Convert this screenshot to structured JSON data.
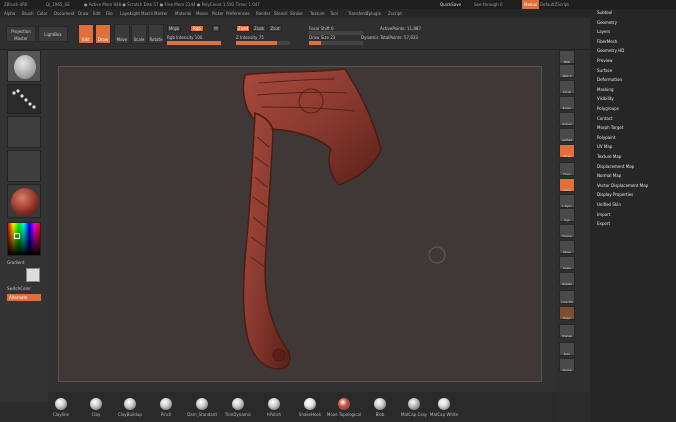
{
  "titlebar": {
    "app": "ZBrush 4R6",
    "file": "Qi_1965_UE",
    "stats": "● Active Mem 848 ● Scratch Disk 57 ● Free Mem 2144 ● PolyCount 1.592 Timer 1.047",
    "quicksave": "QuickSave",
    "see_through": "See-through",
    "see_through_value": "0",
    "menus_label": "Menus",
    "default_script": "DefaultZScript"
  },
  "menubar": [
    "Alpha",
    "Brush",
    "Color",
    "Document",
    "Draw",
    "Edit",
    "File",
    "Layer",
    "Light",
    "Macro",
    "Marker",
    "Material",
    "Movie",
    "Picker",
    "Preferences",
    "Render",
    "Stencil",
    "Stroke",
    "Texture",
    "Tool",
    "Transform",
    "Zplugin",
    "Zscript"
  ],
  "shelf": {
    "projection_master": "Projection Master",
    "lightbox": "LightBox",
    "edit": "Edit",
    "draw": "Draw",
    "move": "Move",
    "scale": "Scale",
    "rotate": "Rotate",
    "mrgb": "Mrgb",
    "rgb": "Rgb",
    "m": "M",
    "zadd": "Zadd",
    "zsub": "Zsub",
    "zcut": "Zcut",
    "rgb_intensity": "Rgb Intensity 100",
    "z_intensity": "Z Intensity 75",
    "focal_shift": "Focal Shift 0",
    "draw_size": "Draw Size 23",
    "dynamic": "Dynamic",
    "active_points": "ActivePoints: 11,887",
    "total_points": "TotalPoints: 57,633",
    "rgb_intensity_level": 1.0,
    "z_intensity_level": 0.75,
    "draw_size_level": 0.23
  },
  "left": {
    "gradient": "Gradient",
    "switch_color": "SwitchColor",
    "alternate": "Alternate"
  },
  "rightstrip": {
    "bpr": "BPR",
    "spix": "SPix 3",
    "scroll": "Scroll",
    "zoom": "Zoom",
    "actual": "Actual",
    "aahalf": "AAHalf",
    "persp": "Persp",
    "floor": "Floor",
    "local": "Local",
    "lsym": "L.Sym",
    "xyz": "Xyz",
    "frame": "Frame",
    "move": "Move",
    "scale": "Scale",
    "rotate": "Rotate",
    "linefill": "Line Fill",
    "polyf": "PolyF",
    "transp": "Transp",
    "solo": "Solo",
    "xpose": "Xpose"
  },
  "rightmenu": [
    "Subtool",
    "Geometry",
    "Layers",
    "FiberMesh",
    "Geometry HD",
    "Preview",
    "Surface",
    "Deformation",
    "Masking",
    "Visibility",
    "Polygroups",
    "Contact",
    "Morph Target",
    "Polypaint",
    "UV Map",
    "Texture Map",
    "Displacement Map",
    "Normal Map",
    "Vector Displacement Map",
    "Display Properties",
    "Unified Skin",
    "Import",
    "Export"
  ],
  "bottom": [
    "Clayline",
    "Clay",
    "ClayBuildup",
    "Pinch",
    "Dam_Standard",
    "TrimDynamic",
    "hPolish",
    "SnakeHook",
    "Move Topological",
    "Blob",
    "MatCap Gray",
    "MatCap White"
  ],
  "colors": {
    "accent": "#e0703a",
    "model": "#8a3a30",
    "bg": "#403836"
  }
}
